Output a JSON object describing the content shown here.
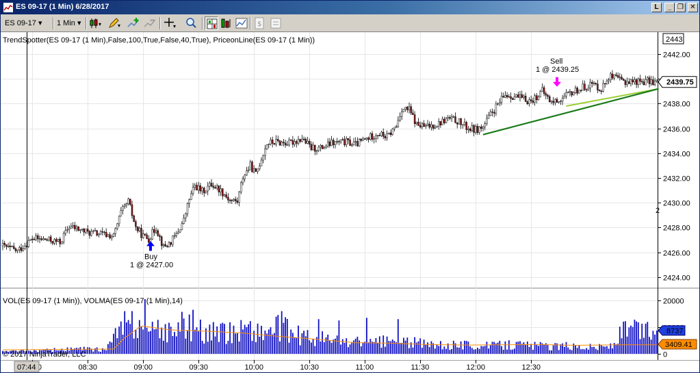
{
  "window": {
    "title": "ES 09-17 (1 Min)  6/28/2017",
    "buttons": [
      "L",
      "_",
      "❐",
      "✕"
    ]
  },
  "toolbar": {
    "instrument": "ES 09-17",
    "interval": "1 Min",
    "tools": [
      {
        "name": "bar-type-icon",
        "icon": "candlestick"
      },
      {
        "name": "draw-pencil-icon",
        "icon": "pencil"
      },
      {
        "name": "add-indicator-icon",
        "icon": "plus"
      },
      {
        "name": "remove-indicator-icon",
        "icon": "minus"
      },
      {
        "name": "crosshair-icon",
        "icon": "crosshair"
      },
      {
        "name": "zoom-icon",
        "icon": "magnifier"
      },
      {
        "name": "chart-style-icon",
        "icon": "grid"
      },
      {
        "name": "properties-icon",
        "icon": "bars"
      },
      {
        "name": "strategy-icon",
        "icon": "chart"
      },
      {
        "name": "dollar-icon",
        "icon": "dollar"
      },
      {
        "name": "data-box-icon",
        "icon": "box"
      }
    ]
  },
  "colors": {
    "up_candle": "#ffffff",
    "down_candle": "#8b1a1a",
    "trend_line": "#1a7a1a",
    "price_line": "#9acd32",
    "volume_bar": "#1010c0",
    "volma_line": "#ff8c00",
    "buy_arrow": "#0000ff",
    "sell_arrow": "#ff00ff",
    "grid": "#e6e6e6",
    "price_marker_bg": "#ffffff",
    "vol_marker_bg": "#1f3fe0",
    "volma_marker_bg": "#ff8c00"
  },
  "chart_data": {
    "type": "candlestick",
    "price_panel": {
      "indicator_label": "TrendSpotter(ES 09-17 (1 Min),False,100,True,False,40,True), PriceonLine(ES 09-17 (1 Min))",
      "ylim": [
        2423,
        2443
      ],
      "yticks": [
        "2424.00",
        "2426.00",
        "2428.00",
        "2430.00",
        "2432.00",
        "2434.00",
        "2436.00",
        "2438.00",
        "2440.00",
        "2442.00"
      ],
      "top_marker": "2443",
      "last_price": "2439.75",
      "right_edge_label": "2"
    },
    "volume_panel": {
      "indicator_label": "VOL(ES 09-17 (1 Min)), VOLMA(ES 09-17 (1 Min),14)",
      "ylim": [
        0,
        22000
      ],
      "yticks": [
        "0",
        "10000",
        "20000"
      ],
      "last_volume": "8737",
      "last_volma": "3409.41"
    },
    "x_axis": {
      "start_label": "07:44",
      "labels": [
        "08:00",
        "08:30",
        "09:00",
        "09:30",
        "10:00",
        "10:30",
        "11:00",
        "11:30",
        "12:00",
        "12:30"
      ]
    },
    "copyright": "© 2017 NinjaTrader, LLC",
    "price_series": [
      {
        "t": 0,
        "v": 2426.5
      },
      {
        "t": 8,
        "v": 2426.1
      },
      {
        "t": 16,
        "v": 2427.1
      },
      {
        "t": 24,
        "v": 2427.0
      },
      {
        "t": 31,
        "v": 2426.8
      },
      {
        "t": 36,
        "v": 2428.1
      },
      {
        "t": 46,
        "v": 2427.6
      },
      {
        "t": 52,
        "v": 2427.5
      },
      {
        "t": 60,
        "v": 2427.3
      },
      {
        "t": 64,
        "v": 2429.2
      },
      {
        "t": 68,
        "v": 2430.1
      },
      {
        "t": 72,
        "v": 2428.0
      },
      {
        "t": 76,
        "v": 2427.3
      },
      {
        "t": 79,
        "v": 2427.1
      },
      {
        "t": 83,
        "v": 2428.0
      },
      {
        "t": 87,
        "v": 2426.4
      },
      {
        "t": 90,
        "v": 2426.7
      },
      {
        "t": 94,
        "v": 2427.4
      },
      {
        "t": 98,
        "v": 2428.6
      },
      {
        "t": 101,
        "v": 2430.3
      },
      {
        "t": 104,
        "v": 2431.4
      },
      {
        "t": 108,
        "v": 2430.9
      },
      {
        "t": 113,
        "v": 2431.5
      },
      {
        "t": 118,
        "v": 2431.0
      },
      {
        "t": 123,
        "v": 2430.2
      },
      {
        "t": 127,
        "v": 2430.1
      },
      {
        "t": 130,
        "v": 2432.1
      },
      {
        "t": 134,
        "v": 2433.0
      },
      {
        "t": 137,
        "v": 2432.3
      },
      {
        "t": 140,
        "v": 2433.6
      },
      {
        "t": 143,
        "v": 2434.8
      },
      {
        "t": 148,
        "v": 2434.9
      },
      {
        "t": 155,
        "v": 2434.8
      },
      {
        "t": 162,
        "v": 2435.2
      },
      {
        "t": 167,
        "v": 2434.4
      },
      {
        "t": 172,
        "v": 2434.4
      },
      {
        "t": 178,
        "v": 2434.8
      },
      {
        "t": 186,
        "v": 2434.9
      },
      {
        "t": 191,
        "v": 2434.7
      },
      {
        "t": 196,
        "v": 2435.1
      },
      {
        "t": 203,
        "v": 2435.6
      },
      {
        "t": 208,
        "v": 2435.3
      },
      {
        "t": 213,
        "v": 2436.2
      },
      {
        "t": 216,
        "v": 2437.6
      },
      {
        "t": 220,
        "v": 2437.5
      },
      {
        "t": 224,
        "v": 2436.3
      },
      {
        "t": 229,
        "v": 2436.1
      },
      {
        "t": 236,
        "v": 2436.4
      },
      {
        "t": 241,
        "v": 2436.8
      },
      {
        "t": 246,
        "v": 2436.6
      },
      {
        "t": 252,
        "v": 2436.0
      },
      {
        "t": 256,
        "v": 2435.9
      },
      {
        "t": 260,
        "v": 2436.1
      },
      {
        "t": 264,
        "v": 2437.1
      },
      {
        "t": 268,
        "v": 2437.9
      },
      {
        "t": 272,
        "v": 2438.7
      },
      {
        "t": 277,
        "v": 2438.6
      },
      {
        "t": 283,
        "v": 2438.3
      },
      {
        "t": 286,
        "v": 2438.2
      },
      {
        "t": 292,
        "v": 2439.0
      },
      {
        "t": 297,
        "v": 2438.1
      },
      {
        "t": 303,
        "v": 2438.4
      },
      {
        "t": 308,
        "v": 2438.9
      },
      {
        "t": 314,
        "v": 2439.3
      },
      {
        "t": 319,
        "v": 2439.6
      },
      {
        "t": 324,
        "v": 2439.2
      },
      {
        "t": 328,
        "v": 2440.2
      },
      {
        "t": 332,
        "v": 2440.0
      },
      {
        "t": 336,
        "v": 2439.8
      }
    ],
    "volume_series": [
      {
        "t": 0,
        "v": 800
      },
      {
        "t": 20,
        "v": 1200
      },
      {
        "t": 40,
        "v": 1800
      },
      {
        "t": 55,
        "v": 1500
      },
      {
        "t": 64,
        "v": 9000
      },
      {
        "t": 72,
        "v": 11000
      },
      {
        "t": 80,
        "v": 8000
      },
      {
        "t": 90,
        "v": 9000
      },
      {
        "t": 100,
        "v": 11000
      },
      {
        "t": 110,
        "v": 8000
      },
      {
        "t": 120,
        "v": 7500
      },
      {
        "t": 130,
        "v": 10000
      },
      {
        "t": 140,
        "v": 8000
      },
      {
        "t": 150,
        "v": 10000
      },
      {
        "t": 160,
        "v": 7000
      },
      {
        "t": 170,
        "v": 6000
      },
      {
        "t": 180,
        "v": 5000
      },
      {
        "t": 190,
        "v": 4500
      },
      {
        "t": 200,
        "v": 4000
      },
      {
        "t": 210,
        "v": 5000
      },
      {
        "t": 220,
        "v": 4500
      },
      {
        "t": 230,
        "v": 3500
      },
      {
        "t": 240,
        "v": 3000
      },
      {
        "t": 250,
        "v": 3500
      },
      {
        "t": 260,
        "v": 3000
      },
      {
        "t": 270,
        "v": 3200
      },
      {
        "t": 280,
        "v": 3500
      },
      {
        "t": 290,
        "v": 3000
      },
      {
        "t": 300,
        "v": 2800
      },
      {
        "t": 310,
        "v": 3000
      },
      {
        "t": 320,
        "v": 2500
      },
      {
        "t": 330,
        "v": 3000
      },
      {
        "t": 336,
        "v": 8737
      }
    ],
    "volume_spikes": [
      {
        "t": 77,
        "v": 20500
      },
      {
        "t": 103,
        "v": 16500
      },
      {
        "t": 151,
        "v": 16000
      },
      {
        "t": 197,
        "v": 13500
      },
      {
        "t": 171,
        "v": 13000
      },
      {
        "t": 214,
        "v": 13000
      },
      {
        "t": 182,
        "v": 12500
      },
      {
        "t": 66,
        "v": 16000
      }
    ],
    "volma_series": [
      {
        "t": 0,
        "v": 1500
      },
      {
        "t": 60,
        "v": 1800
      },
      {
        "t": 66,
        "v": 6000
      },
      {
        "t": 75,
        "v": 10500
      },
      {
        "t": 90,
        "v": 9000
      },
      {
        "t": 110,
        "v": 8500
      },
      {
        "t": 130,
        "v": 7800
      },
      {
        "t": 150,
        "v": 6500
      },
      {
        "t": 170,
        "v": 5500
      },
      {
        "t": 190,
        "v": 4200
      },
      {
        "t": 210,
        "v": 4000
      },
      {
        "t": 230,
        "v": 3500
      },
      {
        "t": 250,
        "v": 3300
      },
      {
        "t": 270,
        "v": 3400
      },
      {
        "t": 290,
        "v": 3500
      },
      {
        "t": 310,
        "v": 3200
      },
      {
        "t": 336,
        "v": 3409.41
      }
    ],
    "trend_line": {
      "t0": 260,
      "v0": 2435.5,
      "t1": 355,
      "v1": 2439.2
    },
    "price_on_line": {
      "t0": 305,
      "v0": 2437.8,
      "t1": 355,
      "v1": 2439.2
    },
    "trades": [
      {
        "side": "Buy",
        "label": "Buy",
        "detail": "1 @ 2427.00",
        "t": 80,
        "price": 2427.0
      },
      {
        "side": "Sell",
        "label": "Sell",
        "detail": "1 @ 2439.25",
        "t": 300,
        "price": 2439.25
      }
    ]
  }
}
